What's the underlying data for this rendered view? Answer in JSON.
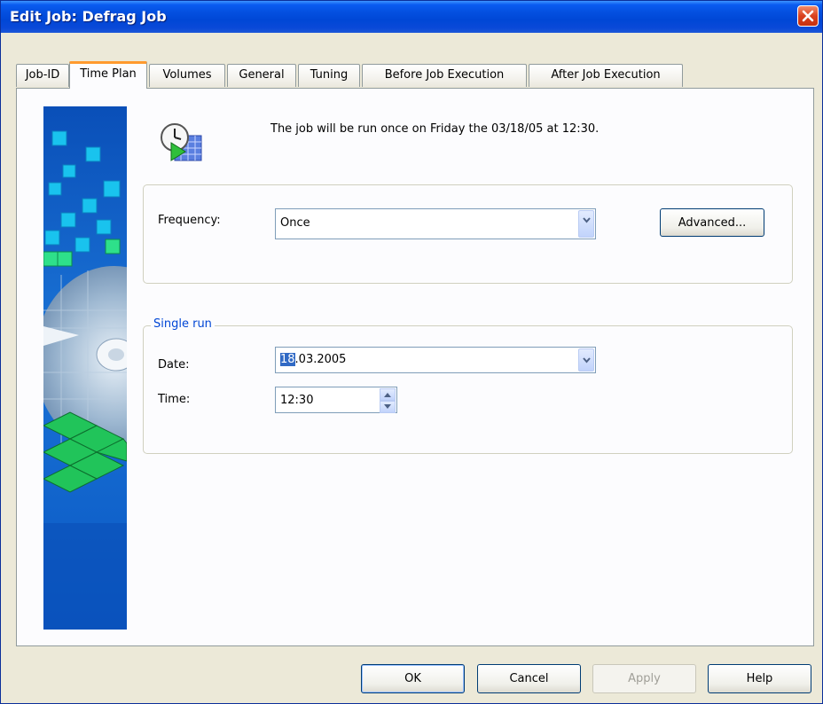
{
  "window": {
    "title": "Edit Job: Defrag Job"
  },
  "tabs": [
    {
      "label": "Job-ID"
    },
    {
      "label": "Time Plan"
    },
    {
      "label": "Volumes"
    },
    {
      "label": "General"
    },
    {
      "label": "Tuning"
    },
    {
      "label": "Before Job Execution"
    },
    {
      "label": "After Job Execution"
    }
  ],
  "active_tab": "Time Plan",
  "info": {
    "text": "The job will be run once on Friday the 03/18/05 at 12:30."
  },
  "frequency": {
    "label": "Frequency:",
    "value": "Once",
    "advanced_label": "Advanced..."
  },
  "single_run": {
    "legend": "Single run",
    "date_label": "Date:",
    "date_selected": "18",
    "date_rest": ".03.2005",
    "time_label": "Time:",
    "time_value": "12:30"
  },
  "buttons": {
    "ok": "OK",
    "cancel": "Cancel",
    "apply": "Apply",
    "help": "Help"
  },
  "colors": {
    "titlebar": "#0047d6",
    "active_tab_accent": "#ff9a2e",
    "legend_text": "#0046d5",
    "selection": "#316ac5"
  },
  "icons": [
    "close-icon",
    "scheduler-clock-icon",
    "dropdown-arrow-icon",
    "spin-up-icon",
    "spin-down-icon"
  ]
}
